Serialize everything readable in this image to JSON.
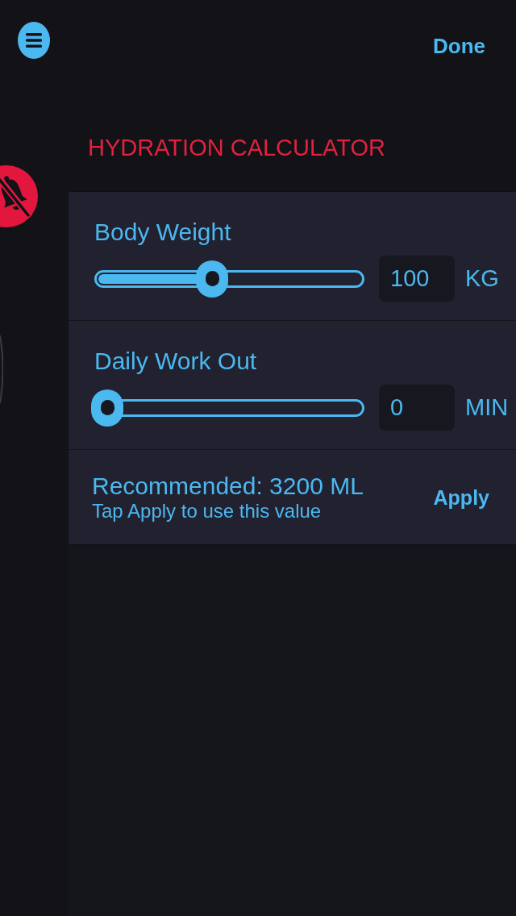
{
  "header": {
    "done_button": "Done",
    "title": "HYDRATION CALCULATOR"
  },
  "sliders": [
    {
      "label": "Body Weight",
      "level": 0.43,
      "value": "100",
      "unit": "KG"
    },
    {
      "label": "Daily Work Out",
      "level": 0,
      "value": "0",
      "unit": "MIN"
    }
  ],
  "recommendation": {
    "text": "Recommended: 3200 ML",
    "hint": "Tap Apply to use this value",
    "apply_button": "Apply"
  }
}
